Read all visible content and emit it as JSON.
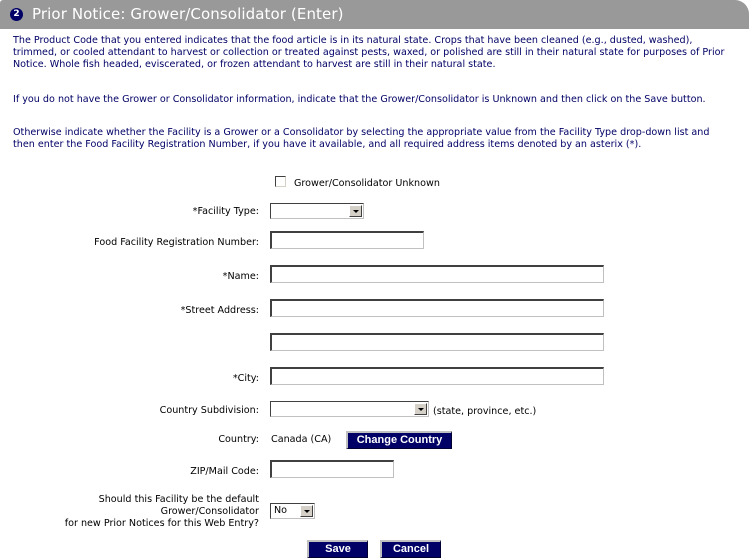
{
  "header": {
    "step_number": "2",
    "title": "Prior Notice: Grower/Consolidator (Enter)"
  },
  "instructions": {
    "p1": "The Product Code that you entered indicates that the food article is in its natural state. Crops that have been cleaned (e.g., dusted, washed), trimmed, or cooled attendant to harvest or collection or treated against pests, waxed, or polished are still in their natural state for purposes of Prior Notice. Whole fish headed, eviscerated, or frozen attendant to harvest are still in their natural state.",
    "p2": "If you do not have the Grower or Consolidator information, indicate that the Grower/Consolidator is Unknown and then click on the Save button.",
    "p3": "Otherwise indicate whether the Facility is a Grower or a Consolidator by selecting the appropriate value from the Facility Type drop-down list and then enter the Food Facility Registration Number, if you have it available, and all required address items denoted by an asterix (*)."
  },
  "form": {
    "unknown_checkbox": {
      "label": "Grower/Consolidator Unknown",
      "checked": false
    },
    "facility_type": {
      "label": "*Facility Type:",
      "value": ""
    },
    "registration_number": {
      "label": "Food Facility Registration Number:",
      "value": ""
    },
    "name": {
      "label": "*Name:",
      "value": ""
    },
    "street_address": {
      "label": "*Street Address:",
      "value": "",
      "value2": ""
    },
    "city": {
      "label": "*City:",
      "value": ""
    },
    "country_subdivision": {
      "label": "Country Subdivision:",
      "value": "",
      "hint": "(state, province, etc.)"
    },
    "country": {
      "label": "Country:",
      "value": "Canada (CA)",
      "change_button": "Change Country"
    },
    "zip": {
      "label": "ZIP/Mail Code:",
      "value": ""
    },
    "default_facility": {
      "label_line1": "Should this Facility be the default",
      "label_line2": "Grower/Consolidator",
      "label_line3": "for new Prior Notices for this Web Entry?",
      "value": "No"
    }
  },
  "actions": {
    "save": "Save",
    "cancel": "Cancel"
  },
  "colors": {
    "header_bg": "#999999",
    "brand_navy": "#000066"
  }
}
